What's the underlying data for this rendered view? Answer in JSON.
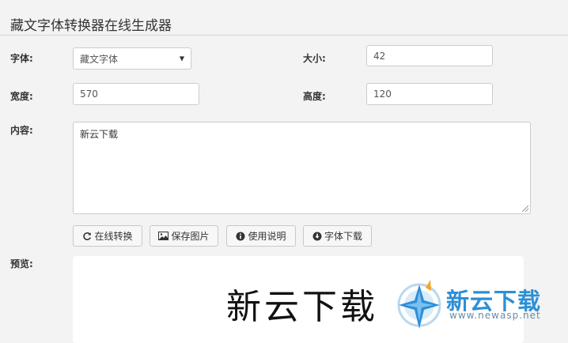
{
  "page": {
    "title": "藏文字体转换器在线生成器"
  },
  "form": {
    "font_label": "字体:",
    "font_selected": "藏文字体",
    "size_label": "大小:",
    "size_value": "42",
    "width_label": "宽度:",
    "width_value": "570",
    "height_label": "高度:",
    "height_value": "120",
    "content_label": "内容:",
    "content_value": "新云下载"
  },
  "buttons": {
    "convert": "在线转换",
    "save_image": "保存图片",
    "help": "使用说明",
    "font_download": "字体下载"
  },
  "preview": {
    "label": "预览:",
    "rendered_text": "新云下载"
  },
  "watermark": {
    "name": "新云下载",
    "url": "www.newasp.net"
  },
  "colors": {
    "background": "#f3f3f3",
    "watermark_blue": "#2d8fd6"
  }
}
